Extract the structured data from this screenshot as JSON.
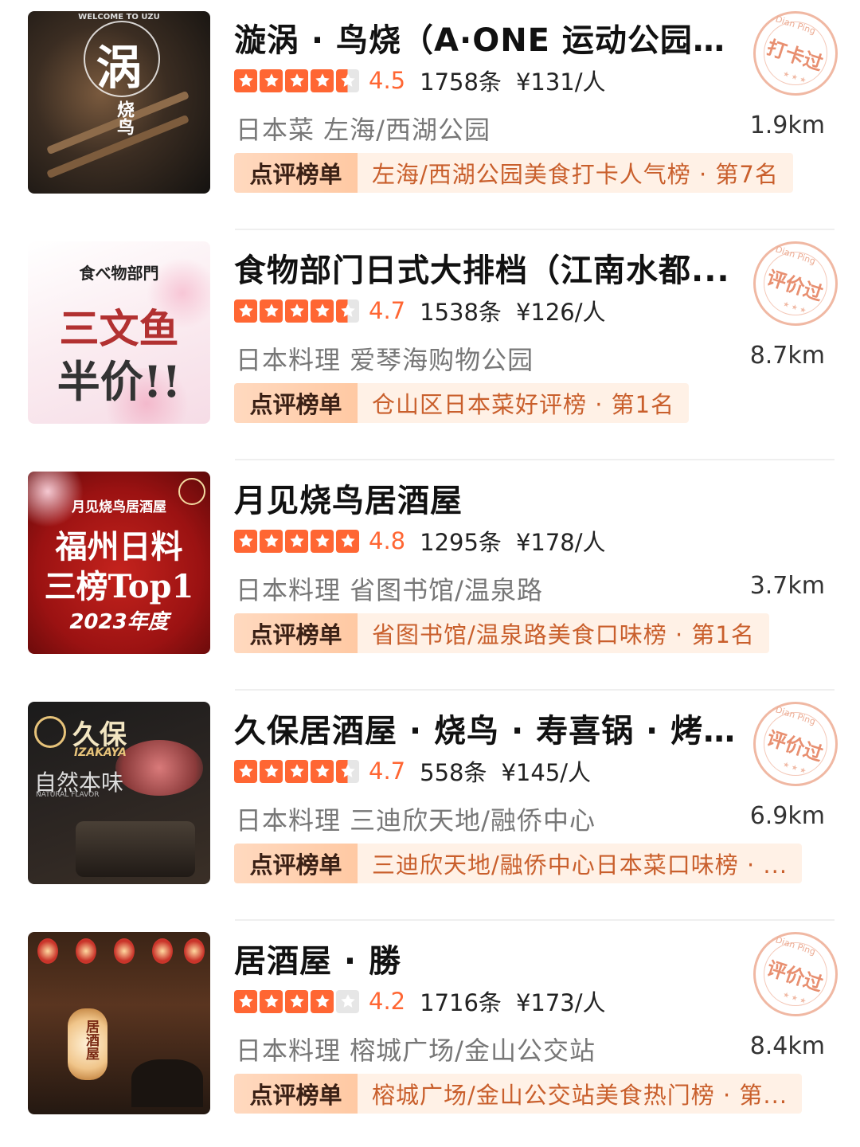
{
  "colors": {
    "star_fill": "#ff6633",
    "star_empty": "#e6e6e6",
    "rating_text": "#ff6633",
    "rank_label_bg": "#ffcfac",
    "rank_text_bg": "#fff1e6",
    "rank_text_color": "#c95f2c",
    "stamp_color": "#e88f70"
  },
  "icons": {
    "star": "star-icon",
    "stamp": "checked-in-stamp"
  },
  "restaurants": [
    {
      "title": "漩涡 · 鸟烧（A·ONE 运动公园店）",
      "rating": "4.5",
      "stars": 4.5,
      "reviews": "1758条",
      "price": "¥131/人",
      "category": "日本菜 左海/西湖公园",
      "distance": "1.9km",
      "rank_label": "点评榜单",
      "rank_text": "左海/西湖公园美食打卡人气榜 · 第7名",
      "stamp": {
        "brand": "Dian Ping",
        "word": "打卡过",
        "dots": "★★★"
      },
      "thumb": {
        "lines": [
          "涡",
          "烧鸟"
        ],
        "caption": "WELCOME TO UZU"
      }
    },
    {
      "title": "食物部门日式大排档（江南水都...",
      "rating": "4.7",
      "stars": 4.5,
      "reviews": "1538条",
      "price": "¥126/人",
      "category": "日本料理 爱琴海购物公园",
      "distance": "8.7km",
      "rank_label": "点评榜单",
      "rank_text": "仓山区日本菜好评榜 · 第1名",
      "stamp": {
        "brand": "Dian Ping",
        "word": "评价过",
        "dots": "★★★"
      },
      "thumb": {
        "lines": [
          "食べ物部門",
          "三文鱼",
          "半价!!"
        ],
        "caption": ""
      }
    },
    {
      "title": "月见烧鸟居酒屋",
      "rating": "4.8",
      "stars": 5,
      "reviews": "1295条",
      "price": "¥178/人",
      "category": "日本料理 省图书馆/温泉路",
      "distance": "3.7km",
      "rank_label": "点评榜单",
      "rank_text": "省图书馆/温泉路美食口味榜 · 第1名",
      "stamp": null,
      "thumb": {
        "lines": [
          "月见烧鸟居酒屋",
          "福州日料",
          "三榜Top1",
          "2023年度"
        ],
        "caption": ""
      }
    },
    {
      "title": "久保居酒屋 · 烧鸟 · 寿喜锅 · 烤...",
      "rating": "4.7",
      "stars": 4.5,
      "reviews": "558条",
      "price": "¥145/人",
      "category": "日本料理 三迪欣天地/融侨中心",
      "distance": "6.9km",
      "rank_label": "点评榜单",
      "rank_text": "三迪欣天地/融侨中心日本菜口味榜 · ...",
      "stamp": {
        "brand": "Dian Ping",
        "word": "评价过",
        "dots": "★★★"
      },
      "thumb": {
        "lines": [
          "久保",
          "IZAKAYA",
          "自然本味",
          "NATURAL FLAVOR"
        ],
        "caption": ""
      }
    },
    {
      "title": "居酒屋 · 勝",
      "rating": "4.2",
      "stars": 4,
      "reviews": "1716条",
      "price": "¥173/人",
      "category": "日本料理 榕城广场/金山公交站",
      "distance": "8.4km",
      "rank_label": "点评榜单",
      "rank_text": "榕城广场/金山公交站美食热门榜 · 第...",
      "stamp": {
        "brand": "Dian Ping",
        "word": "评价过",
        "dots": "★★★"
      },
      "thumb": {
        "lines": [
          "居酒屋"
        ],
        "caption": ""
      }
    }
  ]
}
